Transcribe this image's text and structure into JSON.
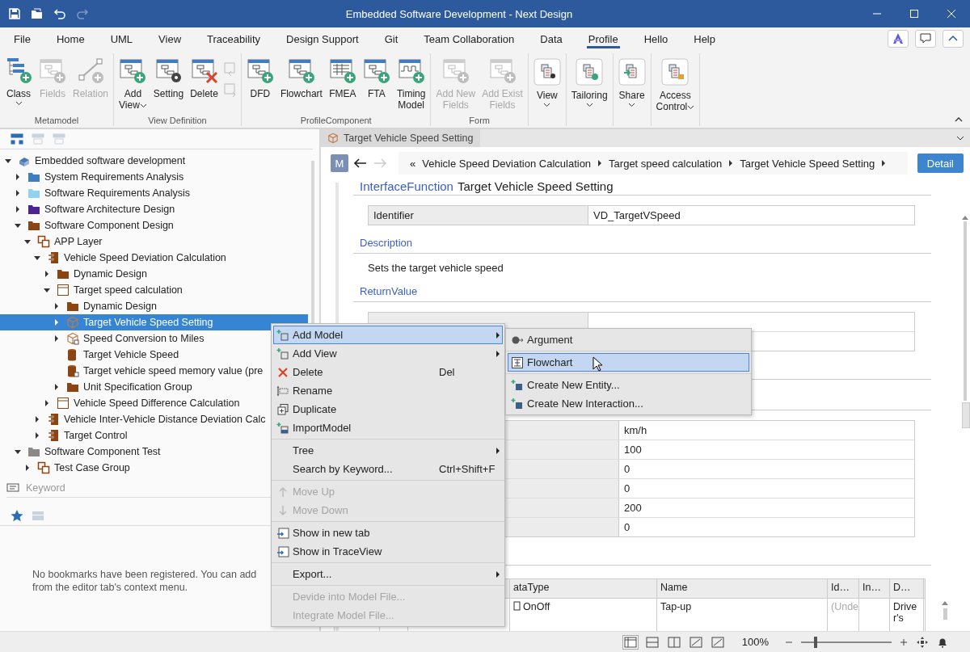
{
  "window": {
    "title": "Embedded Software Development - Next Design"
  },
  "quick_access": [
    {
      "kind": "save",
      "disabled": false
    },
    {
      "kind": "open",
      "disabled": false
    },
    {
      "kind": "undo",
      "disabled": false
    },
    {
      "kind": "redo",
      "disabled": true
    }
  ],
  "menu_tabs": [
    {
      "label": "File",
      "selected": false
    },
    {
      "label": "Home",
      "selected": false
    },
    {
      "label": "UML",
      "selected": false
    },
    {
      "label": "View",
      "selected": false
    },
    {
      "label": "Traceability",
      "selected": false
    },
    {
      "label": "Design Support",
      "selected": false
    },
    {
      "label": "Git",
      "selected": false
    },
    {
      "label": "Team Collaboration",
      "selected": false
    },
    {
      "label": "Data",
      "selected": false
    },
    {
      "label": "Profile",
      "selected": true
    },
    {
      "label": "Hello",
      "selected": false
    },
    {
      "label": "Help",
      "selected": false
    }
  ],
  "ribbon": {
    "groups": [
      {
        "label": "Metamodel",
        "buttons": [
          {
            "lines": [
              "Class"
            ],
            "dropdown": true,
            "disabled": false
          },
          {
            "lines": [
              "Fields"
            ],
            "dropdown": false,
            "disabled": true
          },
          {
            "lines": [
              "Relation"
            ],
            "dropdown": false,
            "disabled": true
          }
        ]
      },
      {
        "label": "View Definition",
        "buttons": [
          {
            "lines": [
              "Add",
              "View"
            ],
            "dropdown": true,
            "disabled": false
          },
          {
            "lines": [
              "Setting"
            ],
            "dropdown": false,
            "disabled": false
          },
          {
            "lines": [
              "Delete"
            ],
            "dropdown": false,
            "disabled": false
          }
        ],
        "small_buttons": [
          {
            "disabled": true
          },
          {
            "disabled": true
          }
        ]
      },
      {
        "label": "ProfileComponent",
        "buttons": [
          {
            "lines": [
              "DFD"
            ],
            "dropdown": false,
            "disabled": false
          },
          {
            "lines": [
              "Flowchart"
            ],
            "dropdown": false,
            "disabled": false
          },
          {
            "lines": [
              "FMEA"
            ],
            "dropdown": false,
            "disabled": false
          },
          {
            "lines": [
              "FTA"
            ],
            "dropdown": false,
            "disabled": false
          },
          {
            "lines": [
              "Timing",
              "Model"
            ],
            "dropdown": false,
            "disabled": false
          }
        ]
      },
      {
        "label": "Form",
        "buttons": [
          {
            "lines": [
              "Add New",
              "Fields"
            ],
            "dropdown": false,
            "disabled": true
          },
          {
            "lines": [
              "Add Exist",
              "Fields"
            ],
            "dropdown": false,
            "disabled": true
          }
        ]
      },
      {
        "buttons": [
          {
            "lines": [
              "View"
            ],
            "dropdown": true,
            "disabled": false
          }
        ]
      },
      {
        "buttons": [
          {
            "lines": [
              "Tailoring"
            ],
            "dropdown": true,
            "disabled": false
          }
        ]
      },
      {
        "buttons": [
          {
            "lines": [
              "Share"
            ],
            "dropdown": true,
            "disabled": false
          }
        ]
      },
      {
        "buttons": [
          {
            "lines": [
              "Access",
              "Control"
            ],
            "dropdown": true,
            "disabled": false
          }
        ]
      }
    ]
  },
  "explorer": {
    "toolbar": [
      {
        "disabled": false
      },
      {
        "disabled": true
      },
      {
        "disabled": true
      }
    ],
    "tree": [
      {
        "label": "Embedded software development",
        "kind": "project",
        "expandable": true,
        "expanded": true,
        "selected": false,
        "children": [
          {
            "label": "System Requirements Analysis",
            "kind": "folder",
            "color": "#3f7cc0",
            "expandable": true,
            "expanded": false,
            "selected": false
          },
          {
            "label": "Software Requirements Analysis",
            "kind": "folder",
            "color": "#8fd3f0",
            "expandable": true,
            "expanded": false,
            "selected": false
          },
          {
            "label": "Software Architecture Design",
            "kind": "folder",
            "color": "#4b2395",
            "expandable": true,
            "expanded": false,
            "selected": false
          },
          {
            "label": "Software Component Design",
            "kind": "folder",
            "color": "#8b4513",
            "expandable": true,
            "expanded": true,
            "selected": false,
            "children": [
              {
                "label": "APP Layer",
                "kind": "layer",
                "expandable": true,
                "expanded": true,
                "selected": false,
                "children": [
                  {
                    "label": "Vehicle Speed Deviation Calculation",
                    "kind": "component",
                    "expandable": true,
                    "expanded": true,
                    "selected": false,
                    "children": [
                      {
                        "label": "Dynamic Design",
                        "kind": "folder",
                        "color": "#8b4513",
                        "expandable": true,
                        "expanded": false,
                        "selected": false
                      },
                      {
                        "label": "Target speed calculation",
                        "kind": "class",
                        "expandable": true,
                        "expanded": true,
                        "selected": false,
                        "children": [
                          {
                            "label": "Dynamic Design",
                            "kind": "folder",
                            "color": "#8b4513",
                            "expandable": true,
                            "expanded": false,
                            "selected": false
                          },
                          {
                            "label": "Target Vehicle Speed Setting",
                            "kind": "interface",
                            "expandable": true,
                            "expanded": false,
                            "selected": true
                          },
                          {
                            "label": "Speed Conversion to Miles",
                            "kind": "interface-locked",
                            "expandable": true,
                            "expanded": false,
                            "selected": false
                          },
                          {
                            "label": "Target Vehicle Speed",
                            "kind": "data",
                            "expandable": false,
                            "selected": false
                          },
                          {
                            "label": "Target vehicle speed memory value (pre",
                            "kind": "data-locked",
                            "expandable": false,
                            "selected": false
                          },
                          {
                            "label": "Unit Specification Group",
                            "kind": "folder",
                            "color": "#8b4513",
                            "expandable": true,
                            "expanded": false,
                            "selected": false
                          }
                        ]
                      },
                      {
                        "label": "Vehicle Speed Difference Calculation",
                        "kind": "class",
                        "expandable": true,
                        "expanded": false,
                        "selected": false
                      }
                    ]
                  },
                  {
                    "label": "Vehicle Inter-Vehicle Distance Deviation Calc",
                    "kind": "component",
                    "expandable": true,
                    "expanded": false,
                    "selected": false
                  },
                  {
                    "label": "Target Control",
                    "kind": "component",
                    "expandable": true,
                    "expanded": false,
                    "selected": false
                  }
                ]
              }
            ]
          },
          {
            "label": "Software Component Test",
            "kind": "folder",
            "color": "#8a8a8a",
            "expandable": true,
            "expanded": true,
            "selected": false,
            "children": [
              {
                "label": "Test Case Group",
                "kind": "layer",
                "expandable": true,
                "expanded": false,
                "selected": false
              }
            ]
          }
        ]
      }
    ],
    "search": {
      "placeholder": "Keyword"
    }
  },
  "bookmarks": {
    "toolbar": [
      {
        "disabled": false
      },
      {
        "disabled": true
      }
    ],
    "message_lines": [
      "No bookmarks have been registered. You can add",
      "from the editor tab's context menu."
    ]
  },
  "editor": {
    "tab": {
      "label": "Target Vehicle Speed Setting"
    },
    "model_badge": "M",
    "back_disabled": false,
    "forward_disabled": true,
    "breadcrumb_lead": "«",
    "breadcrumb": [
      "Vehicle Speed Deviation Calculation",
      "Target speed calculation",
      "Target Vehicle Speed Setting"
    ],
    "detail_button": "Detail",
    "heading": {
      "type": "InterfaceFunction",
      "name": "Target Vehicle Speed Setting"
    },
    "identifier": {
      "label": "Identifier",
      "value": "VD_TargetVSpeed"
    },
    "description": {
      "title": "Description",
      "text": "Sets the target vehicle speed"
    },
    "return_value": {
      "title": "ReturnValue"
    },
    "property_values": [
      "km/h",
      "100",
      "0",
      "0",
      "200",
      "0"
    ],
    "parameters": {
      "columns": [
        "ataType",
        "Name",
        "Id…",
        "In…",
        "D…"
      ],
      "rows": [
        {
          "cells": [
            "OnOff",
            "Tap-up",
            "(Unde",
            "",
            "Driver's"
          ],
          "placeholder_cells": [
            false,
            false,
            true,
            false,
            false
          ]
        }
      ]
    }
  },
  "status_bar": {
    "zoom": "100%",
    "zoom_slider": {
      "level": 0.16
    }
  },
  "context_menu": {
    "items": [
      {
        "kind": "item",
        "label": "Add Model",
        "submenu": true,
        "selected": true,
        "disabled": false
      },
      {
        "kind": "item",
        "label": "Add View",
        "submenu": true,
        "selected": false,
        "disabled": false
      },
      {
        "kind": "item",
        "label": "Delete",
        "shortcut": "Del",
        "submenu": false,
        "selected": false,
        "disabled": false
      },
      {
        "kind": "item",
        "label": "Rename",
        "submenu": false,
        "selected": false,
        "disabled": false
      },
      {
        "kind": "item",
        "label": "Duplicate",
        "submenu": false,
        "selected": false,
        "disabled": false
      },
      {
        "kind": "item",
        "label": "ImportModel",
        "submenu": false,
        "selected": false,
        "disabled": false
      },
      {
        "kind": "separator"
      },
      {
        "kind": "item",
        "label": "Tree",
        "submenu": true,
        "selected": false,
        "disabled": false
      },
      {
        "kind": "item",
        "label": "Search by Keyword...",
        "shortcut": "Ctrl+Shift+F",
        "submenu": false,
        "selected": false,
        "disabled": false
      },
      {
        "kind": "separator"
      },
      {
        "kind": "item",
        "label": "Move Up",
        "submenu": false,
        "selected": false,
        "disabled": true
      },
      {
        "kind": "item",
        "label": "Move Down",
        "submenu": false,
        "selected": false,
        "disabled": true
      },
      {
        "kind": "separator"
      },
      {
        "kind": "item",
        "label": "Show in new tab",
        "submenu": false,
        "selected": false,
        "disabled": false
      },
      {
        "kind": "item",
        "label": "Show in TraceView",
        "submenu": false,
        "selected": false,
        "disabled": false
      },
      {
        "kind": "separator"
      },
      {
        "kind": "item",
        "label": "Export...",
        "submenu": true,
        "selected": false,
        "disabled": false
      },
      {
        "kind": "separator"
      },
      {
        "kind": "item",
        "label": "Devide into Model File...",
        "submenu": false,
        "selected": false,
        "disabled": true
      },
      {
        "kind": "item",
        "label": "Integrate Model File...",
        "submenu": false,
        "selected": false,
        "disabled": true
      }
    ]
  },
  "submenu": {
    "items": [
      {
        "kind": "item",
        "label": "Argument",
        "selected": false
      },
      {
        "kind": "separator"
      },
      {
        "kind": "item",
        "label": "Flowchart",
        "selected": true
      },
      {
        "kind": "separator"
      },
      {
        "kind": "item",
        "label": "Create New Entity...",
        "selected": false
      },
      {
        "kind": "item",
        "label": "Create New Interaction...",
        "selected": false
      }
    ]
  }
}
